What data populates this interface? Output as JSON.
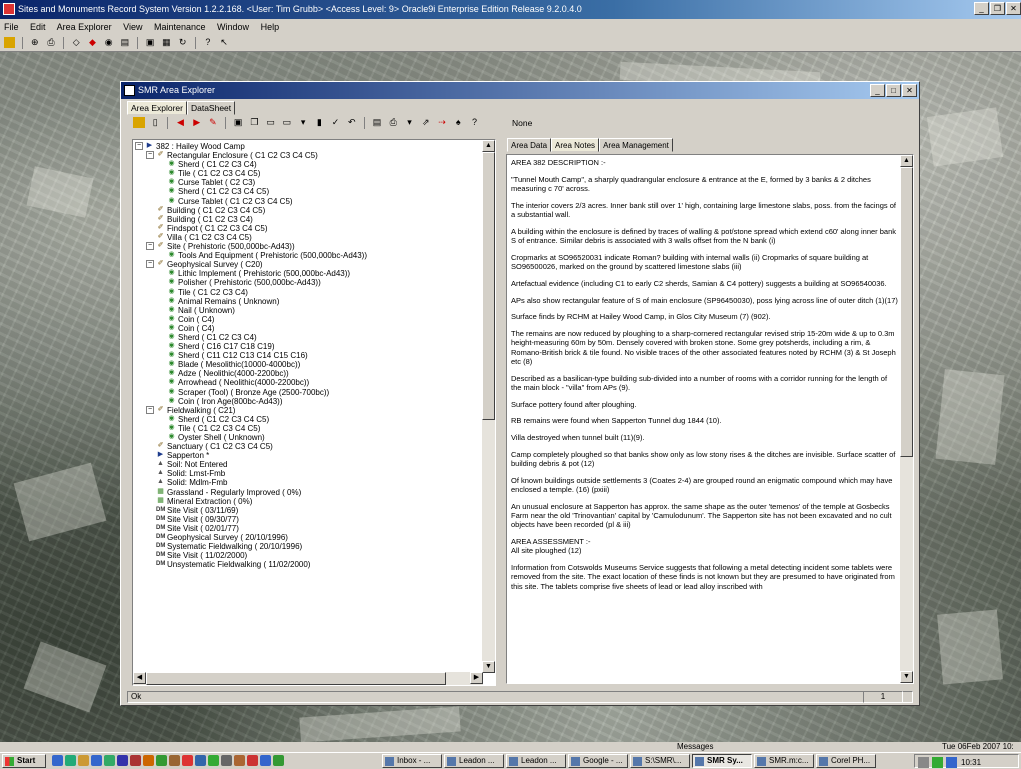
{
  "app": {
    "title": "Sites and Monuments Record System Version 1.2.2.168. <User: Tim Grubb> <Access Level: 9> Oracle9i Enterprise Edition Release 9.2.0.4.0",
    "menu": [
      "File",
      "Edit",
      "Area Explorer",
      "View",
      "Maintenance",
      "Window",
      "Help"
    ]
  },
  "explorer": {
    "title": "SMR Area Explorer",
    "tabs": [
      "Area Explorer",
      "DataSheet"
    ],
    "none_label": "None",
    "tree": [
      {
        "d": 0,
        "t": "-",
        "i": "site",
        "label": "382 : Hailey Wood Camp"
      },
      {
        "d": 1,
        "t": "-",
        "i": "pen",
        "label": "Rectangular Enclosure ( C1 C2 C3 C4 C5)"
      },
      {
        "d": 2,
        "i": "disc",
        "label": "Sherd ( C1 C2 C3 C4)"
      },
      {
        "d": 2,
        "i": "disc",
        "label": "Tile ( C1 C2 C3 C4 C5)"
      },
      {
        "d": 2,
        "i": "disc",
        "label": "Curse Tablet ( C2 C3)"
      },
      {
        "d": 2,
        "i": "disc",
        "label": "Sherd ( C1 C2 C3 C4 C5)"
      },
      {
        "d": 2,
        "i": "disc",
        "label": "Curse Tablet ( C1 C2 C3 C4 C5)"
      },
      {
        "d": 1,
        "i": "pen",
        "label": "Building ( C1 C2 C3 C4 C5)"
      },
      {
        "d": 1,
        "i": "pen",
        "label": "Building ( C1 C2 C3 C4)"
      },
      {
        "d": 1,
        "i": "pen",
        "label": "Findspot ( C1 C2 C3 C4 C5)"
      },
      {
        "d": 1,
        "i": "pen",
        "label": "Villa ( C1 C2 C3 C4 C5)"
      },
      {
        "d": 1,
        "t": "-",
        "i": "pen",
        "label": "Site ( Prehistoric (500,000bc-Ad43))"
      },
      {
        "d": 2,
        "i": "disc",
        "label": "Tools And Equipment ( Prehistoric (500,000bc-Ad43))"
      },
      {
        "d": 1,
        "t": "-",
        "i": "pen",
        "label": "Geophysical Survey ( C20)"
      },
      {
        "d": 2,
        "i": "disc",
        "label": "Lithic Implement ( Prehistoric (500,000bc-Ad43))"
      },
      {
        "d": 2,
        "i": "disc",
        "label": "Polisher ( Prehistoric (500,000bc-Ad43))"
      },
      {
        "d": 2,
        "i": "disc",
        "label": "Tile ( C1 C2 C3 C4)"
      },
      {
        "d": 2,
        "i": "disc",
        "label": "Animal Remains ( Unknown)"
      },
      {
        "d": 2,
        "i": "disc",
        "label": "Nail ( Unknown)"
      },
      {
        "d": 2,
        "i": "disc",
        "label": "Coin ( C4)"
      },
      {
        "d": 2,
        "i": "disc",
        "label": "Coin ( C4)"
      },
      {
        "d": 2,
        "i": "disc",
        "label": "Sherd ( C1 C2 C3 C4)"
      },
      {
        "d": 2,
        "i": "disc",
        "label": "Sherd ( C16 C17 C18 C19)"
      },
      {
        "d": 2,
        "i": "disc",
        "label": "Sherd ( C11 C12 C13 C14 C15 C16)"
      },
      {
        "d": 2,
        "i": "disc",
        "label": "Blade ( Mesolithic(10000-4000bc))"
      },
      {
        "d": 2,
        "i": "disc",
        "label": "Adze ( Neolithic(4000-2200bc))"
      },
      {
        "d": 2,
        "i": "disc",
        "label": "Arrowhead ( Neolithic(4000-2200bc))"
      },
      {
        "d": 2,
        "i": "disc",
        "label": "Scraper (Tool) ( Bronze Age (2500-700bc))"
      },
      {
        "d": 2,
        "i": "disc",
        "label": "Coin ( Iron Age(800bc-Ad43))"
      },
      {
        "d": 1,
        "t": "-",
        "i": "pen",
        "label": "Fieldwalking ( C21)"
      },
      {
        "d": 2,
        "i": "disc",
        "label": "Sherd ( C1 C2 C3 C4 C5)"
      },
      {
        "d": 2,
        "i": "disc",
        "label": "Tile ( C1 C2 C3 C4 C5)"
      },
      {
        "d": 2,
        "i": "disc",
        "label": "Oyster Shell ( Unknown)"
      },
      {
        "d": 1,
        "i": "pen",
        "label": "Sanctuary ( C1 C2 C3 C4 C5)"
      },
      {
        "d": 1,
        "i": "site",
        "label": "Sapperton *"
      },
      {
        "d": 1,
        "i": "soil",
        "label": "Soil: Not Entered"
      },
      {
        "d": 1,
        "i": "soil",
        "label": "Solid: Lmst-Fmb"
      },
      {
        "d": 1,
        "i": "soil",
        "label": "Solid: Mdlm-Fmb"
      },
      {
        "d": 1,
        "i": "land",
        "label": "Grassland - Regularly Improved ( 0%)"
      },
      {
        "d": 1,
        "i": "land",
        "label": "Mineral Extraction ( 0%)"
      },
      {
        "d": 1,
        "i": "visit",
        "label": "Site Visit ( 03/11/69)"
      },
      {
        "d": 1,
        "i": "visit",
        "label": "Site Visit ( 09/30/77)"
      },
      {
        "d": 1,
        "i": "visit",
        "label": "Site Visit ( 02/01/77)"
      },
      {
        "d": 1,
        "i": "visit",
        "label": "Geophysical Survey ( 20/10/1996)"
      },
      {
        "d": 1,
        "i": "visit",
        "label": "Systematic Fieldwalking ( 20/10/1996)"
      },
      {
        "d": 1,
        "i": "visit",
        "label": "Site Visit ( 11/02/2000)"
      },
      {
        "d": 1,
        "i": "visit",
        "label": "Unsystematic Fieldwalking ( 11/02/2000)"
      }
    ],
    "right_tabs": [
      "Area Data",
      "Area Notes",
      "Area Management"
    ],
    "notes": [
      "AREA 382 DESCRIPTION :-",
      "\"Tunnel Mouth Camp\", a sharply quadrangular enclosure & entrance at the E, formed by 3 banks & 2 ditches measuring c 70' across.",
      "The interior covers 2/3 acres. Inner bank still over 1' high, containing large limestone slabs, poss. from the facings of a substantial wall.",
      "A building within the enclosure is defined by traces of walling & pot/stone spread which extend c60' along inner bank S of entrance. Similar debris is associated with 3 walls offset from the N bank (i)",
      "Cropmarks at SO96520031 indicate Roman? building with internal walls (ii) Cropmarks of square building at SO96500026, marked on the ground by scattered limestone slabs (iii)",
      "Artefactual evidence (including C1 to early C2 sherds, Samian & C4 pottery) suggests a building at SO96540036.",
      "APs also show rectangular feature of S of main enclosure (SP96450030), poss lying across line of outer ditch (1)(17)",
      "Surface finds by RCHM at Hailey Wood Camp, in Glos City Museum (7) (902).",
      "The remains are now reduced by ploughing to a sharp-cornered rectangular revised strip 15-20m wide & up to 0.3m height-measuring 60m by 50m. Densely covered with broken stone. Some grey potsherds, including a rim, & Romano-British brick & tile found. No visible traces of the other associated features noted by RCHM (3) & St Joseph etc (8)",
      "Described as a basilican-type building sub-divided into a number of rooms with a corridor running for the length of the main block - \"villa\" from APs (9).",
      "Surface pottery found after ploughing.",
      "RB remains were found when Sapperton Tunnel dug 1844 (10).",
      "Villa destroyed when tunnel built (11)(9).",
      "Camp completely ploughed so that banks show only as low stony rises & the ditches are invisible. Surface scatter of building debris & pot (12)",
      "Of known buildings outside settlements 3 (Coates 2-4) are grouped round an enigmatic compound which may have enclosed a temple. (16) (pxiii)",
      "An unusual enclosure at Sapperton has approx. the same shape as the outer 'temenos' of the temple at Gosbecks Farm near the old 'Trinovantian' capital by 'Camulodunum'. The Sapperton site has not been excavated and no cult objects have been recorded (pl & iii)",
      "AREA ASSESSMENT :-\nAll site ploughed (12)",
      "Information from Cotswolds Museums Service suggests that following a metal detecting incident some tablets were removed from the site. The exact location of these finds is not known but they are presumed to have originated from this site. The tablets comprise five sheets of lead or lead alloy inscribed with"
    ],
    "status_left": "Ok",
    "status_page": "1"
  },
  "bottom": {
    "messages_label": "Messages",
    "date": "Tue 06Feb 2007 10:",
    "start_label": "Start",
    "tasks": [
      "Inbox - ...",
      "Leadon ...",
      "Leadon ...",
      "Google - ...",
      "S:\\SMR\\...",
      "SMR Sy...",
      "SMR.m:c...",
      "Corel PH..."
    ],
    "active_task_index": 5,
    "clock": "10:31"
  },
  "colors": {
    "title_active": "#0a246a",
    "face": "#d4d0c8",
    "accent": "#3a6ea5"
  }
}
